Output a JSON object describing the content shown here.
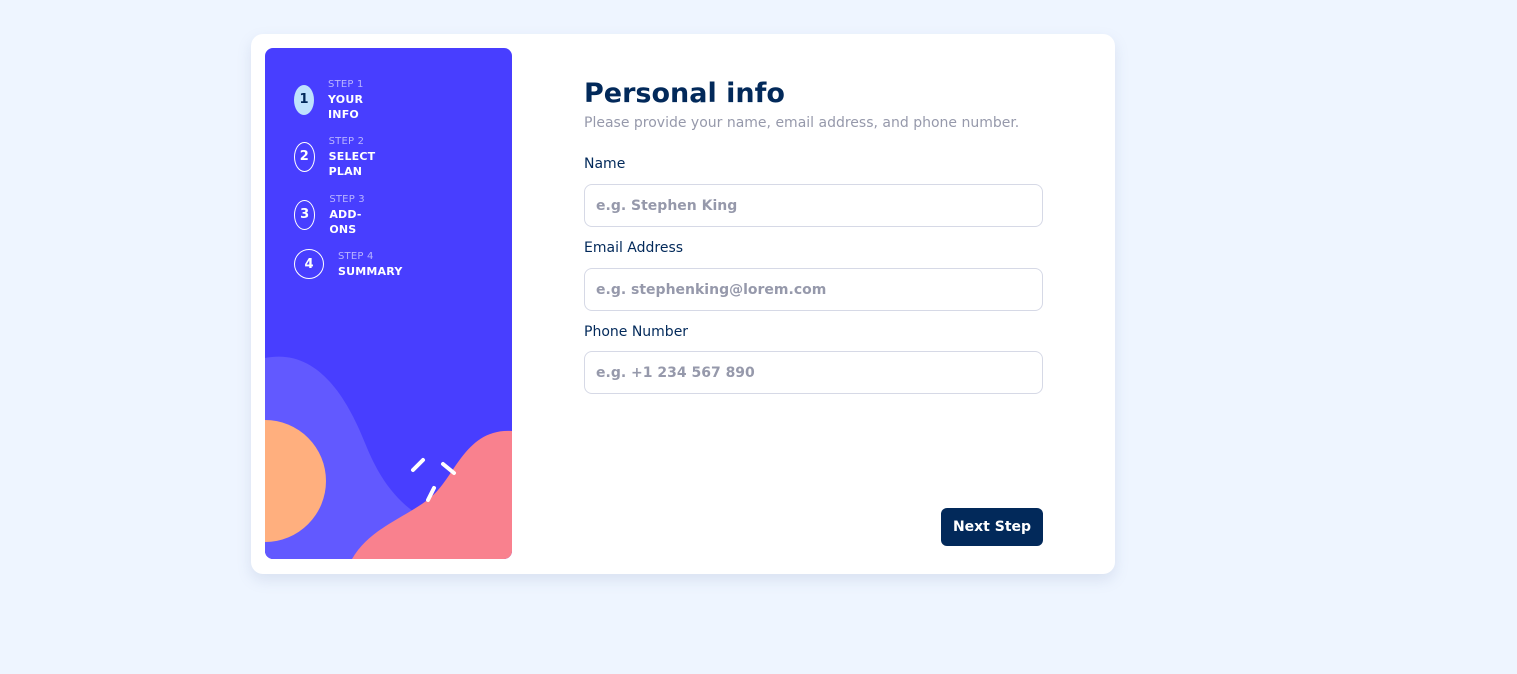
{
  "sidebar": {
    "steps": [
      {
        "number": "1",
        "caption": "STEP 1",
        "title": "YOUR INFO",
        "active": true
      },
      {
        "number": "2",
        "caption": "STEP 2",
        "title": "SELECT PLAN",
        "active": false
      },
      {
        "number": "3",
        "caption": "STEP 3",
        "title": "ADD-ONS",
        "active": false
      },
      {
        "number": "4",
        "caption": "STEP 4",
        "title": "SUMMARY",
        "active": false
      }
    ]
  },
  "form": {
    "title": "Personal info",
    "subtitle": "Please provide your name, email address, and phone number.",
    "fields": [
      {
        "label": "Name",
        "placeholder": "e.g. Stephen King",
        "value": ""
      },
      {
        "label": "Email Address",
        "placeholder": "e.g. stephenking@lorem.com",
        "value": ""
      },
      {
        "label": "Phone Number",
        "placeholder": "e.g. +1 234 567 890",
        "value": ""
      }
    ],
    "next_label": "Next Step"
  },
  "colors": {
    "background": "#eef5ff",
    "sidebar": "#483eff",
    "active_step": "#bfe2fd",
    "primary_text": "#02295a",
    "muted_text": "#9699ab",
    "border": "#d6d9e6"
  }
}
